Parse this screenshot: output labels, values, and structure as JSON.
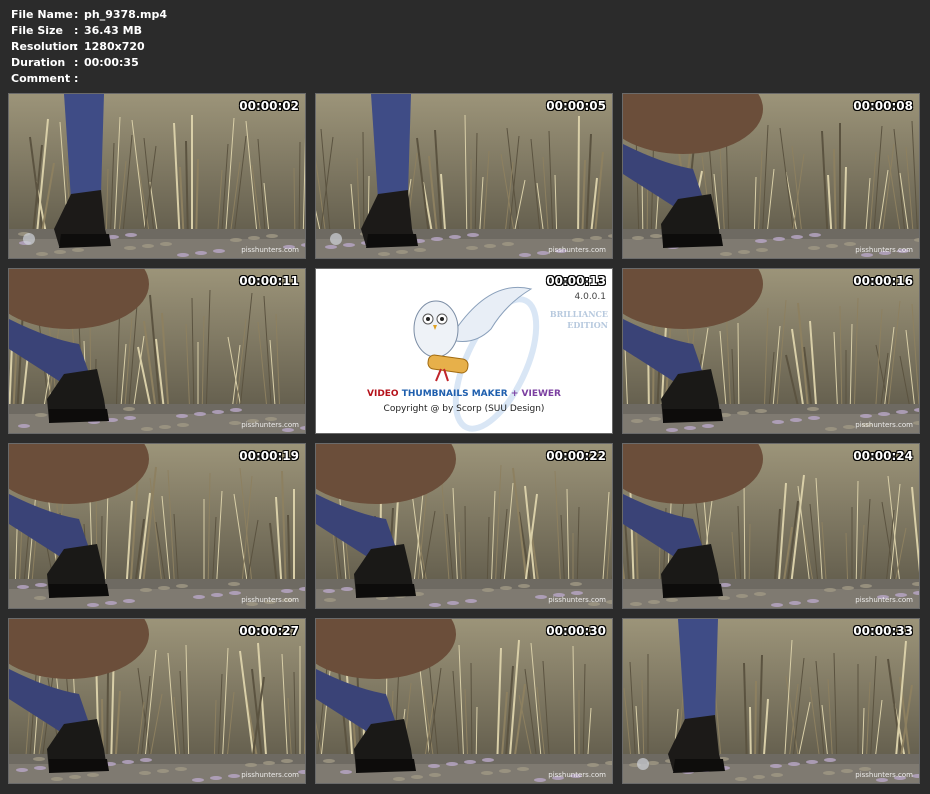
{
  "info": {
    "rows": [
      {
        "key": "File Name",
        "value": "ph_9378.mp4"
      },
      {
        "key": "File Size",
        "value": "36.43 MB"
      },
      {
        "key": "Resolution",
        "value": "1280x720"
      },
      {
        "key": "Duration",
        "value": "00:00:35"
      },
      {
        "key": "Comment",
        "value": ""
      }
    ],
    "separator": ":"
  },
  "watermark": "pisshunters.com",
  "thumbs": [
    {
      "time": "00:00:02",
      "scene": "boots-legs"
    },
    {
      "time": "00:00:05",
      "scene": "boots-legs"
    },
    {
      "time": "00:00:08",
      "scene": "squat"
    },
    {
      "time": "00:00:11",
      "scene": "squat"
    },
    {
      "time": "00:00:13",
      "scene": "splash"
    },
    {
      "time": "00:00:16",
      "scene": "squat"
    },
    {
      "time": "00:00:19",
      "scene": "squat"
    },
    {
      "time": "00:00:22",
      "scene": "squat"
    },
    {
      "time": "00:00:24",
      "scene": "squat"
    },
    {
      "time": "00:00:27",
      "scene": "squat"
    },
    {
      "time": "00:00:30",
      "scene": "squat"
    },
    {
      "time": "00:00:33",
      "scene": "boots-legs"
    }
  ],
  "splash": {
    "version": "4.0.0.1",
    "edition_line1": "BRILLIANCE",
    "edition_line2": "EDITION",
    "title_video": "VIDEO",
    "title_thumbs": "THUMBNAILS MAKER",
    "title_plus": " + ",
    "title_viewer": "VIEWER",
    "copyright": "Copyright @ by Scorp (SUU Design)"
  },
  "colors": {
    "background": "#2b2b2b",
    "text": "#ffffff",
    "thumb_border": "#6a6a6a"
  }
}
